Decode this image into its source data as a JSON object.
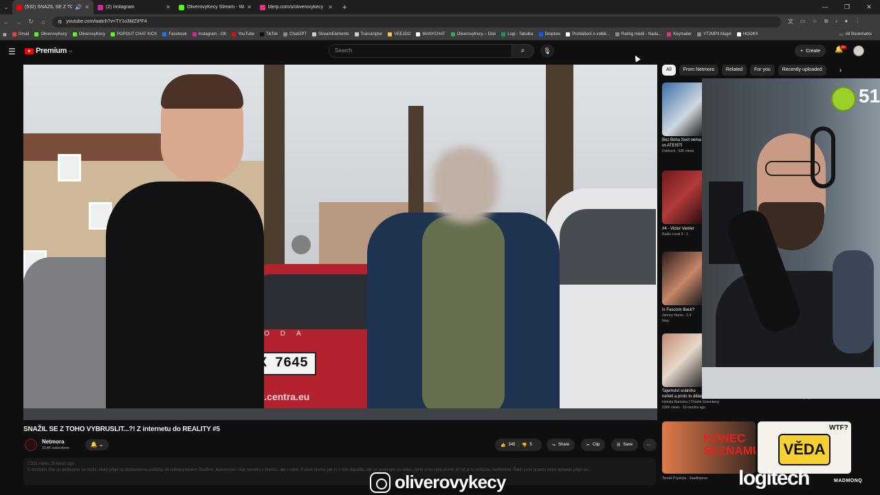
{
  "browser": {
    "tabs": [
      {
        "title": "(532) SNAŽIL SE Z TOHO V",
        "color": "#ff0000",
        "active": true
      },
      {
        "title": "(2) Instagram",
        "color": "#d6249f",
        "active": false
      },
      {
        "title": "OliverovyKecy Stream - Watch",
        "color": "#53fc18",
        "active": false
      },
      {
        "title": "blerp.com/s/oliverovykecy",
        "color": "#e7337a",
        "active": false
      }
    ],
    "url": "youtube.com/watch?v=TY1o3MZIPF4",
    "bookmarks": [
      {
        "label": "Gmail",
        "color": "#ea4335"
      },
      {
        "label": "OliverovyKecy",
        "color": "#53fc18"
      },
      {
        "label": "OliverovyKecy",
        "color": "#53fc18"
      },
      {
        "label": "POPOUT CHAT KICK",
        "color": "#53fc18"
      },
      {
        "label": "Facebook",
        "color": "#1877f2"
      },
      {
        "label": "Instagram - OK",
        "color": "#d6249f"
      },
      {
        "label": "YouTube",
        "color": "#ff0000"
      },
      {
        "label": "TikTok",
        "color": "#111111"
      },
      {
        "label": "ChatGPT",
        "color": "#888888"
      },
      {
        "label": "StreamElements",
        "color": "#cccccc"
      },
      {
        "label": "Transkriptor",
        "color": "#cccccc"
      },
      {
        "label": "VEEJDO",
        "color": "#f2c94c"
      },
      {
        "label": "MANYCHAT",
        "color": "#ffffff"
      },
      {
        "label": "OliverovyKecy – Disk",
        "color": "#34a853"
      },
      {
        "label": "Logi - Tabulka",
        "color": "#0f9d58"
      },
      {
        "label": "Dropbox",
        "color": "#0061fe"
      },
      {
        "label": "Prohlášení o volbě...",
        "color": "#ffffff"
      },
      {
        "label": "Rating médií - Nada...",
        "color": "#888888"
      },
      {
        "label": "Keymailer",
        "color": "#e7337a"
      },
      {
        "label": "YT2MP3 Magic",
        "color": "#888888"
      },
      {
        "label": "HOOKS",
        "color": "#ffffff"
      }
    ],
    "all_bookmarks": "All Bookmarks"
  },
  "youtube": {
    "logo_text": "Premium",
    "logo_region": "CZ",
    "search_placeholder": "Search",
    "create_label": "Create",
    "notif_badge": "9+",
    "video": {
      "plate_text": "X 7645",
      "car_brand": "ODA",
      "car_url": "www.centra.eu"
    },
    "title": "SNAŽIL SE Z TOHO VYBRUSLIT...?! Z internetu do REALITY #5",
    "channel": {
      "name": "Netmora",
      "subs": "10.4K subscribers"
    },
    "actions": {
      "likes": "345",
      "dislikes": "5",
      "share": "Share",
      "clip": "Clip",
      "save": "Save"
    },
    "description": {
      "meta": "2,521 views  25 hours ago",
      "text": "V dnešním díle se podíváme na muže, který přijel na domluvenou schůzku do města jménem Stodhov. Konverzaci však nemělo s Anetou, ale s námi. Pokud nevíte, jak to s ním dopadlo, tak se podívejte na video, ještě si ho také všimli. Ať už je to schůzka nezřetelná. Řekli jsme pravdu nebo opravdu přijel se..."
    },
    "chips": [
      "All",
      "From Netmora",
      "Related",
      "For you",
      "Recently uploaded"
    ],
    "recommendations": [
      {
        "title": "Bez Boha život nema",
        "sub": "vs ATEISTI",
        "channel": "Dukkock · 53K views"
      },
      {
        "title": "#4 - Victor Verrier",
        "sub": "",
        "channel": "Radio Local 9 · 1"
      },
      {
        "title": "Is Fascism Back?",
        "sub": "",
        "channel": "Johnny Harris · 2.4",
        "tag": "New"
      },
      {
        "title": "Tajemství orálního",
        "sub": "neřekl a proto to dělas pořád dál",
        "channel": "Intimita Narovinu | Charlie Greenberg",
        "views": "239K views · 10 months ago"
      }
    ],
    "rec_bottom": [
      {
        "title_text": "KONEC SEZNAMU?",
        "caption": "Tomáš Pryskyla · Saadlopova"
      },
      {
        "title_text": "VĚDA",
        "badge": "WTF?"
      }
    ],
    "rec_right_caption": "Lukáš Vitek · 33K views · 1 day ago",
    "rec_right_tag": "New"
  },
  "facecam": {
    "counter": "51"
  },
  "stream_overlay": {
    "handle": "oliverovykecy",
    "sponsor1": "logitech",
    "sponsor2": "MADMONQ"
  }
}
